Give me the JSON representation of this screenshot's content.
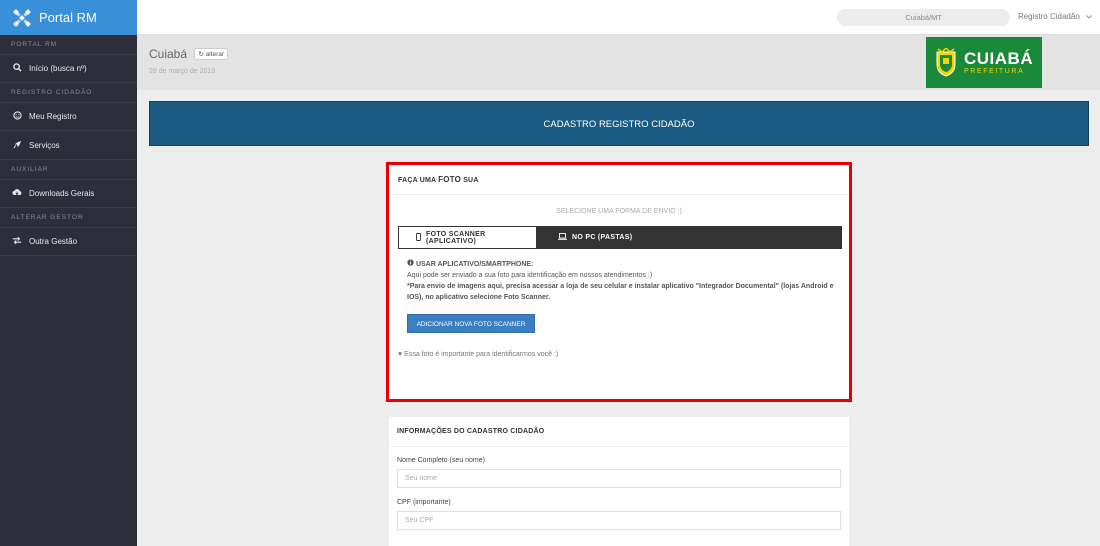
{
  "brand": {
    "name": "Portal RM"
  },
  "sidebar": {
    "sections": [
      {
        "title": "PORTAL RM",
        "items": [
          {
            "label": "Início (busca nº)",
            "icon": "search-icon"
          }
        ]
      },
      {
        "title": "REGISTRO CIDADÃO",
        "items": [
          {
            "label": "Meu Registro",
            "icon": "smile-icon"
          },
          {
            "label": "Serviços",
            "icon": "rocket-icon"
          }
        ]
      },
      {
        "title": "AUXILIAR",
        "items": [
          {
            "label": "Downloads Gerais",
            "icon": "cloud-download-icon"
          }
        ]
      },
      {
        "title": "ALTERAR GESTOR",
        "items": [
          {
            "label": "Outra Gestão",
            "icon": "exchange-icon"
          }
        ]
      }
    ]
  },
  "topbar": {
    "location": "Cuiabá/MT",
    "user_menu": "Registro Cidadão"
  },
  "header": {
    "city": "Cuiabá",
    "alterar": "alterar",
    "date": "28 de março de 2019"
  },
  "prefeitura": {
    "name": "CUIABÁ",
    "subtitle": "PREFEITURA"
  },
  "banner": {
    "title": "CADASTRO REGISTRO CIDADÃO"
  },
  "photo_card": {
    "title_prefix": "FAÇA UMA ",
    "title_bold": "FOTO",
    "title_suffix": " SUA",
    "select_prompt": "SELECIONE UMA FORMA DE ENVIO :)",
    "tabs": [
      {
        "label": "FOTO SCANNER (APLICATIVO)",
        "active": true
      },
      {
        "label": "NO PC (PASTAS)",
        "active": false
      }
    ],
    "app_title": "USAR APLICATIVO/SMARTPHONE:",
    "app_line1": "Aqui pode ser enviado a sua foto para identificação em nossos atendimentos :)",
    "app_line2": "*Para envio de imagens aqui, precisa acessar a loja de seu celular e instalar aplicativo \"Integrador Documental\" (lojas Android e IOS), no aplicativo selecione Foto Scanner.",
    "add_button": "ADICIONAR NOVA FOTO SCANNER",
    "note": "Essa foto é importante para identificarmos você :)"
  },
  "info_card": {
    "title": "INFORMAÇÕES DO CADASTRO CIDADÃO",
    "fields": [
      {
        "label": "Nome Completo (seu nome)",
        "placeholder": "Seu nome"
      },
      {
        "label": "CPF (importante)",
        "placeholder": "Seu CPF"
      }
    ]
  },
  "colors": {
    "sidebar": "#2c2f3a",
    "brand": "#3a8fd9",
    "banner": "#1b5a82",
    "highlight": "#e60000",
    "prefeitura_green": "#1a8a3a",
    "button": "#3a7fc1"
  }
}
